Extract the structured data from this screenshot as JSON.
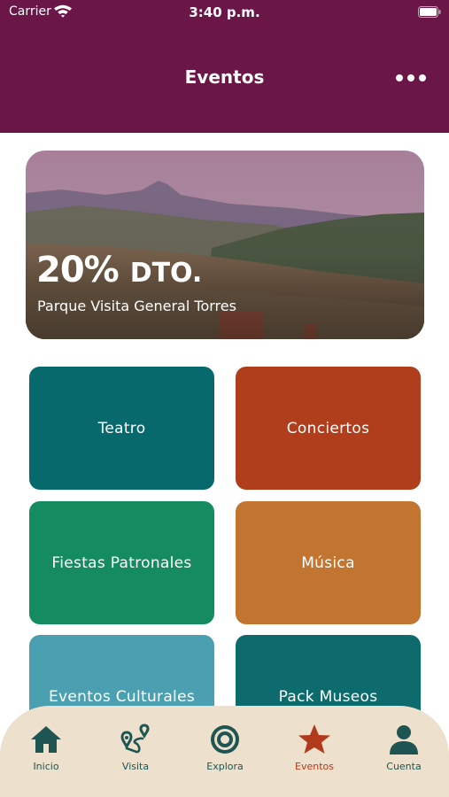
{
  "status_bar": {
    "carrier": "Carrier",
    "time": "3:40 p.m."
  },
  "header": {
    "title": "Eventos"
  },
  "promo": {
    "discount": "20%",
    "discount_suffix": "DTO.",
    "subtitle": "Parque Visita General Torres"
  },
  "categories": [
    {
      "label": "Teatro",
      "color": "#08696d"
    },
    {
      "label": "Conciertos",
      "color": "#b03d1c"
    },
    {
      "label": "Fiestas Patronales",
      "color": "#148c5f"
    },
    {
      "label": "Música",
      "color": "#c27431"
    },
    {
      "label": "Eventos Culturales",
      "color": "#4aa0b0"
    },
    {
      "label": "Pack Museos",
      "color": "#0d6a6d"
    }
  ],
  "tabbar": {
    "items": [
      {
        "label": "Inicio",
        "icon": "home-icon"
      },
      {
        "label": "Visita",
        "icon": "map-route-icon"
      },
      {
        "label": "Explora",
        "icon": "target-icon"
      },
      {
        "label": "Eventos",
        "icon": "star-icon"
      },
      {
        "label": "Cuenta",
        "icon": "user-icon"
      }
    ],
    "active_color": "#b23a1c",
    "inactive_color": "#1e5552"
  },
  "theme": {
    "header": "#6a1748",
    "tabbar_bg": "#ede0cd"
  }
}
